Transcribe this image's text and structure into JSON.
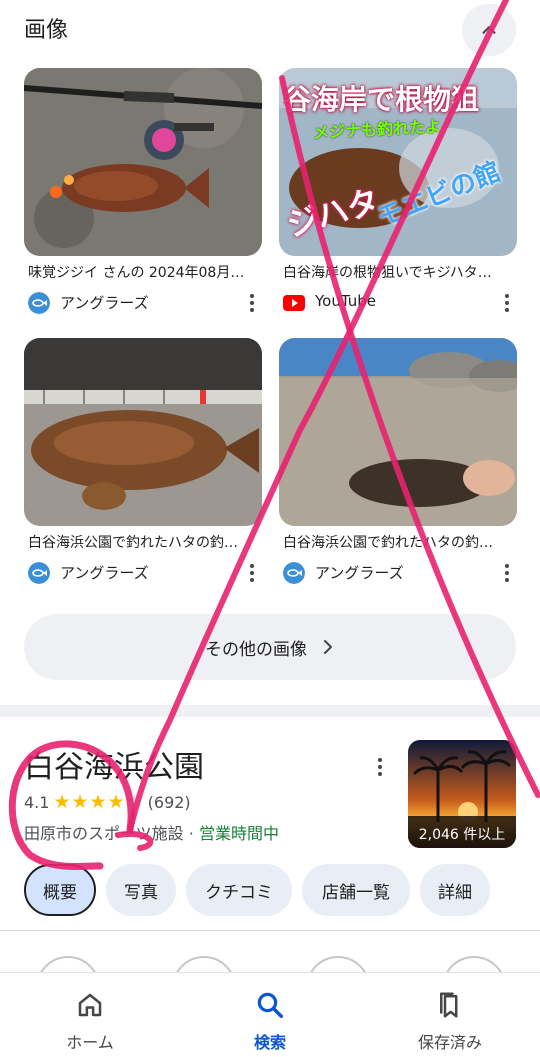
{
  "images_section": {
    "title": "画像",
    "cards": [
      {
        "caption": "味覚ジジイ さんの 2024年08月…",
        "source": "アングラーズ",
        "source_icon": "anglers-fish-icon"
      },
      {
        "caption": "白谷海岸の根物狙いでキジハタ…",
        "source": "YouTube",
        "source_icon": "youtube-icon",
        "overlay_title": "谷海岸で根物狙",
        "overlay_sub": "メジナも釣れたよ",
        "overlay_left": "ジハタ",
        "overlay_right": "モエビの館"
      },
      {
        "caption": "白谷海浜公園で釣れたハタの釣…",
        "source": "アングラーズ",
        "source_icon": "anglers-fish-icon"
      },
      {
        "caption": "白谷海浜公園で釣れたハタの釣…",
        "source": "アングラーズ",
        "source_icon": "anglers-fish-icon"
      }
    ],
    "more_label": "その他の画像"
  },
  "place": {
    "name": "白谷海浜公園",
    "rating": "4.1",
    "rating_value": 4.1,
    "review_count": "(692)",
    "category": "田原市のスポーツ施設",
    "separator": " · ",
    "status": "営業時間中",
    "photo_count": "2,046 件以上",
    "tabs": [
      "概要",
      "写真",
      "クチコミ",
      "店舗一覧",
      "詳細"
    ]
  },
  "bottom_nav": [
    {
      "label": "ホーム",
      "icon": "home-icon"
    },
    {
      "label": "検索",
      "icon": "search-icon"
    },
    {
      "label": "保存済み",
      "icon": "bookmark-icon"
    }
  ],
  "colors": {
    "accent": "#0b57d0",
    "star": "#fbbc04",
    "open_status": "#188038",
    "chip_bg": "#e9eef6",
    "annotation": "#e8226f",
    "youtube": "#ff0000",
    "anglers": "#3b8fd6"
  }
}
